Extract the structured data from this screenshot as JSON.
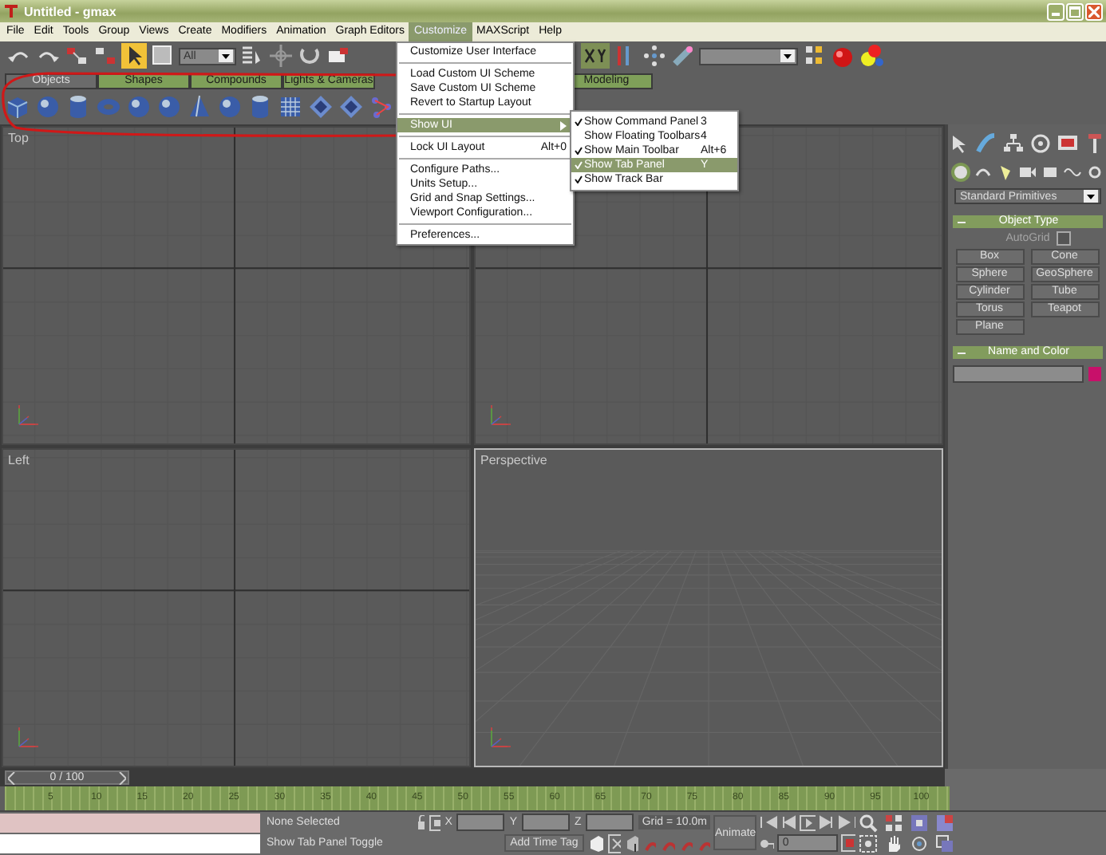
{
  "window": {
    "title": "Untitled - gmax"
  },
  "menu_bar": [
    {
      "label": "File",
      "selected": false
    },
    {
      "label": "Edit",
      "selected": false
    },
    {
      "label": "Tools",
      "selected": false
    },
    {
      "label": "Group",
      "selected": false
    },
    {
      "label": "Views",
      "selected": false
    },
    {
      "label": "Create",
      "selected": false
    },
    {
      "label": "Modifiers",
      "selected": false
    },
    {
      "label": "Animation",
      "selected": false
    },
    {
      "label": "Graph Editors",
      "selected": false
    },
    {
      "label": "Customize",
      "selected": true
    },
    {
      "label": "MAXScript",
      "selected": false
    },
    {
      "label": "Help",
      "selected": false
    }
  ],
  "main_toolbar": {
    "selection_filter": "All"
  },
  "tabs": [
    {
      "label": "Objects",
      "selected": true
    },
    {
      "label": "Shapes",
      "selected": false
    },
    {
      "label": "Compounds",
      "selected": false
    },
    {
      "label": "Lights & Cameras",
      "selected": false
    },
    {
      "label": "Modeling",
      "selected": false
    }
  ],
  "viewports": [
    {
      "label": "Top",
      "kind": "ortho",
      "active": false
    },
    {
      "kind": "ortho",
      "active": false
    },
    {
      "label": "Left",
      "kind": "ortho",
      "active": false
    },
    {
      "label": "Perspective",
      "kind": "perspective",
      "active": true
    }
  ],
  "command_panel": {
    "category": "Standard Primitives",
    "object_type": {
      "title": "Object Type",
      "autogrid": {
        "label": "AutoGrid",
        "checked": false,
        "disabled": true
      },
      "buttons": [
        "Box",
        "Cone",
        "Sphere",
        "GeoSphere",
        "Cylinder",
        "Tube",
        "Torus",
        "Teapot",
        "Plane"
      ]
    },
    "name_and_color": {
      "title": "Name and Color",
      "color": "#c8106a"
    }
  },
  "time_slider": {
    "label": "0 / 100",
    "level": 0
  },
  "track_bar": {
    "ticks": [
      "5",
      "10",
      "15",
      "20",
      "25",
      "30",
      "35",
      "40",
      "45",
      "50",
      "55",
      "60",
      "65",
      "70",
      "75",
      "80",
      "85",
      "90",
      "95",
      "100"
    ]
  },
  "status": {
    "selection": "None Selected",
    "prompt": "Show Tab Panel Toggle",
    "x_label": "X",
    "y_label": "Y",
    "z_label": "Z",
    "grid": "Grid = 10.0m",
    "animate": "Animate",
    "time_tag": "Add Time Tag",
    "frame": "0"
  },
  "customize_menu": [
    {
      "kind": "item",
      "label": "Customize User Interface",
      "selected": false
    },
    {
      "kind": "separator"
    },
    {
      "kind": "item",
      "label": "Load Custom UI Scheme",
      "selected": false
    },
    {
      "kind": "item",
      "label": "Save Custom UI Scheme",
      "selected": false
    },
    {
      "kind": "item",
      "label": "Revert to Startup Layout",
      "selected": false
    },
    {
      "kind": "separator"
    },
    {
      "kind": "submenu",
      "label": "Show UI",
      "selected": true
    },
    {
      "kind": "separator"
    },
    {
      "kind": "item",
      "label": "Lock UI Layout",
      "shortcut": "Alt+0",
      "selected": false
    },
    {
      "kind": "separator"
    },
    {
      "kind": "item",
      "label": "Configure Paths...",
      "selected": false
    },
    {
      "kind": "item",
      "label": "Units Setup...",
      "selected": false
    },
    {
      "kind": "item",
      "label": "Grid and Snap Settings...",
      "selected": false
    },
    {
      "kind": "item",
      "label": "Viewport Configuration...",
      "selected": false
    },
    {
      "kind": "separator"
    },
    {
      "kind": "item",
      "label": "Preferences...",
      "selected": false
    }
  ],
  "show_ui_submenu": [
    {
      "label": "Show Command Panel",
      "shortcut": "3",
      "checked": true,
      "selected": false
    },
    {
      "label": "Show Floating Toolbars",
      "shortcut": "4",
      "checked": false,
      "selected": false
    },
    {
      "label": "Show Main Toolbar",
      "shortcut": "Alt+6",
      "checked": true,
      "selected": false
    },
    {
      "label": "Show Tab Panel",
      "shortcut": "Y",
      "checked": true,
      "selected": true
    },
    {
      "label": "Show Track Bar",
      "checked": true,
      "selected": false
    }
  ]
}
